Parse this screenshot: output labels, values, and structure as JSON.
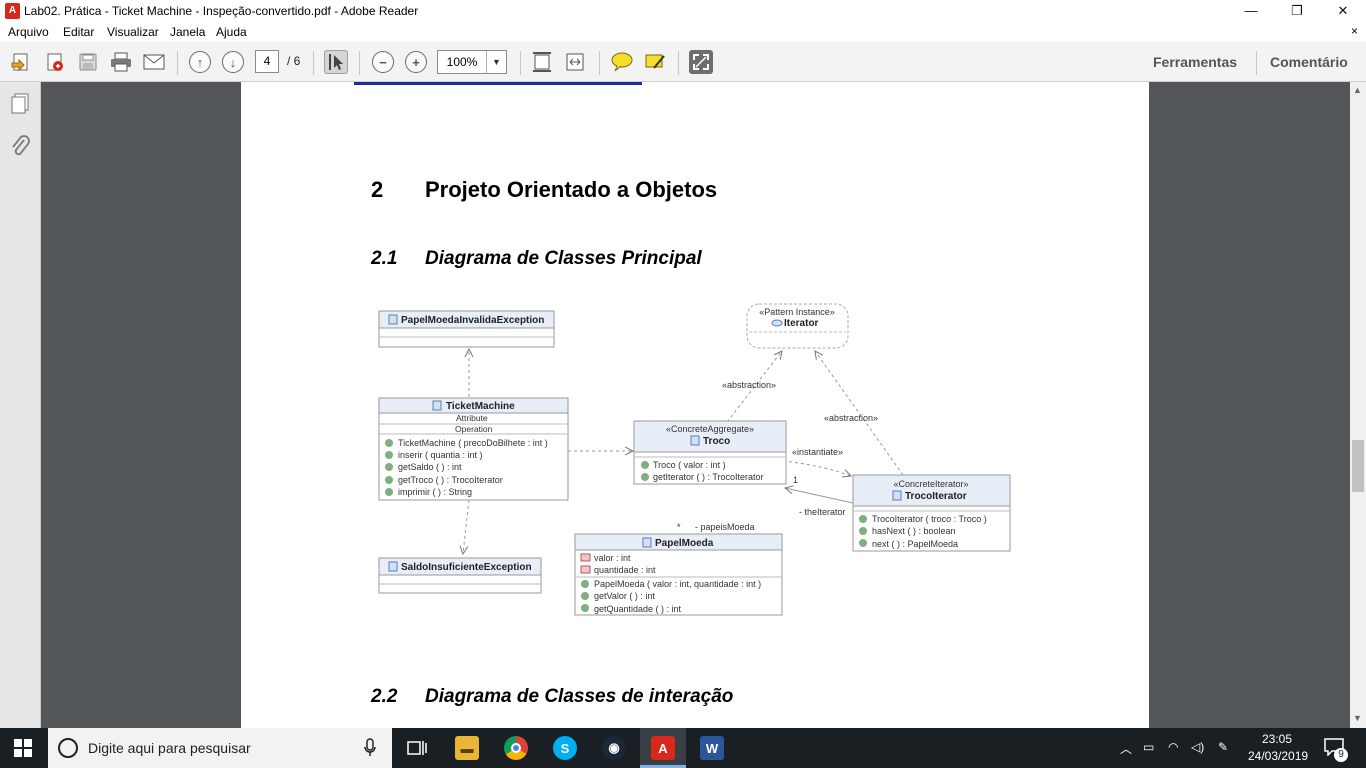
{
  "window": {
    "title": "Lab02. Prática - Ticket Machine - Inspeção-convertido.pdf - Adobe Reader",
    "minimize": "—",
    "restore": "❐",
    "close": "✕"
  },
  "menu": {
    "items": [
      "Arquivo",
      "Editar",
      "Visualizar",
      "Janela",
      "Ajuda"
    ],
    "close_glyph": "×"
  },
  "toolbar": {
    "page_current": "4",
    "page_total": "/ 6",
    "zoom": "100%",
    "tools_label": "Ferramentas",
    "comment_label": "Comentário"
  },
  "document": {
    "section_number": "2",
    "section_title": "Projeto Orientado a Objetos",
    "subsection_1_number": "2.1",
    "subsection_1_title": "Diagrama de Classes Principal",
    "subsection_2_number": "2.2",
    "subsection_2_title": "Diagrama de Classes de interação",
    "diagram": {
      "papel_exc": "PapelMoedaInvalidaException",
      "saldo_exc": "SaldoInsuficienteException",
      "ticket": {
        "name": "TicketMachine",
        "attr_label": "Attribute",
        "op_label": "Operation",
        "ops": [
          "TicketMachine ( precoDoBilhete : int )",
          "inserir ( quantia : int )",
          "getSaldo ( ) : int",
          "getTroco ( ) : TrocoIterator",
          "imprimir ( ) : String"
        ]
      },
      "iterator": {
        "stereotype": "«Pattern Instance»",
        "name": "Iterator"
      },
      "troco": {
        "stereotype": "«ConcreteAggregate»",
        "name": "Troco",
        "ops": [
          "Troco ( valor : int )",
          "getIterator ( ) : TrocoIterator"
        ]
      },
      "troco_iterator": {
        "stereotype": "«ConcreteIterator»",
        "name": "TrocoIterator",
        "ops": [
          "TrocoIterator ( troco : Troco )",
          "hasNext ( ) : boolean",
          "next ( ) : PapelMoeda"
        ]
      },
      "papel_moeda": {
        "name": "PapelMoeda",
        "attrs": [
          "valor : int",
          "quantidade : int"
        ],
        "ops": [
          "PapelMoeda ( valor : int, quantidade : int )",
          "getValor ( ) : int",
          "getQuantidade ( ) : int"
        ]
      },
      "labels": {
        "abstraction_1": "«abstraction»",
        "abstraction_2": "«abstraction»",
        "instantiate": "«instantiate»",
        "the_iterator": "- theIterator",
        "mult_one": "1",
        "mult_many": "*",
        "papeis_moeda": "- papeisMoeda"
      }
    }
  },
  "taskbar": {
    "search_placeholder": "Digite aqui para pesquisar",
    "time": "23:05",
    "date": "24/03/2019",
    "notification_count": "9"
  },
  "colors": {
    "doc_bg": "#525659",
    "taskbar": "#1a1f24",
    "accent_red": "#d8281b",
    "uml_header": "#e8eef8"
  }
}
